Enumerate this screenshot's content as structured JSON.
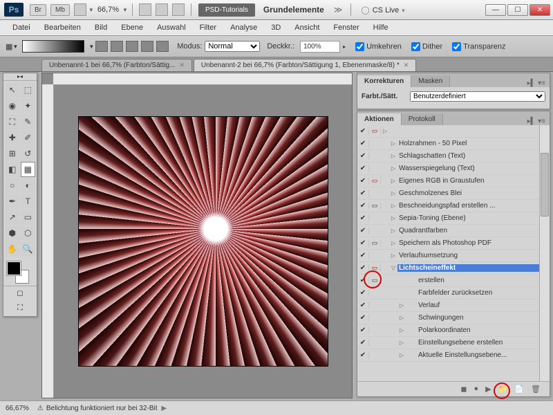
{
  "title": {
    "workspace": "PSD-Tutorials",
    "doc": "Grundelemente",
    "zoom": "66,7%",
    "cslive": "CS Live",
    "chips": [
      "Br",
      "Mb"
    ]
  },
  "menu": [
    "Datei",
    "Bearbeiten",
    "Bild",
    "Ebene",
    "Auswahl",
    "Filter",
    "Analyse",
    "3D",
    "Ansicht",
    "Fenster",
    "Hilfe"
  ],
  "opt": {
    "modus_lbl": "Modus:",
    "modus_val": "Normal",
    "deck_lbl": "Deckkr.:",
    "deck_val": "100%",
    "umk": "Umkehren",
    "dit": "Dither",
    "tra": "Transparenz"
  },
  "tabs": [
    {
      "label": "Unbenannt-1 bei 66,7% (Farbton/Sättig...",
      "active": false
    },
    {
      "label": "Unbenannt-2 bei 66,7% (Farbton/Sättigung 1, Ebenenmaske/8) *",
      "active": true
    }
  ],
  "corr": {
    "tabs": [
      "Korrekturen",
      "Masken"
    ],
    "field_lbl": "Farbt./Sätt.",
    "preset": "Benutzerdefiniert"
  },
  "act": {
    "tabs": [
      "Aktionen",
      "Protokoll"
    ],
    "items": [
      {
        "ck": "✔",
        "md": "▭",
        "mdred": true,
        "tg": "▷",
        "name": "",
        "ind": 0
      },
      {
        "ck": "✔",
        "md": "",
        "tg": "▷",
        "name": "Holzrahmen - 50 Pixel",
        "ind": 1
      },
      {
        "ck": "✔",
        "md": "",
        "tg": "▷",
        "name": "Schlagschatten (Text)",
        "ind": 1
      },
      {
        "ck": "✔",
        "md": "",
        "tg": "▷",
        "name": "Wasserspiegelung (Text)",
        "ind": 1
      },
      {
        "ck": "✔",
        "md": "▭",
        "mdred": true,
        "tg": "▷",
        "name": "Eigenes RGB in Graustufen",
        "ind": 1
      },
      {
        "ck": "✔",
        "md": "",
        "tg": "▷",
        "name": "Geschmolzenes Blei",
        "ind": 1
      },
      {
        "ck": "✔",
        "md": "▭",
        "tg": "▷",
        "name": "Beschneidungspfad erstellen ...",
        "ind": 1
      },
      {
        "ck": "✔",
        "md": "",
        "tg": "▷",
        "name": "Sepia-Toning (Ebene)",
        "ind": 1
      },
      {
        "ck": "✔",
        "md": "",
        "tg": "▷",
        "name": "Quadrantfarben",
        "ind": 1
      },
      {
        "ck": "✔",
        "md": "▭",
        "tg": "▷",
        "name": "Speichern als Photoshop PDF",
        "ind": 1
      },
      {
        "ck": "✔",
        "md": "",
        "tg": "▷",
        "name": "Verlaufsumsetzung",
        "ind": 1
      },
      {
        "ck": "✔",
        "md": "▭",
        "mdred": true,
        "tg": "▽",
        "name": "Lichtscheineffekt",
        "ind": 1,
        "sel": true
      },
      {
        "ck": "✔",
        "md": "▭",
        "tg": "",
        "name": "erstellen",
        "ind": 2
      },
      {
        "ck": "✔",
        "md": "",
        "tg": "",
        "name": "Farbfelder zurücksetzen",
        "ind": 2
      },
      {
        "ck": "✔",
        "md": "",
        "tg": "▷",
        "name": "Verlauf",
        "ind": 2
      },
      {
        "ck": "✔",
        "md": "",
        "tg": "▷",
        "name": "Schwingungen",
        "ind": 2
      },
      {
        "ck": "✔",
        "md": "",
        "tg": "▷",
        "name": "Polarkoordinaten",
        "ind": 2
      },
      {
        "ck": "✔",
        "md": "",
        "tg": "▷",
        "name": "Einstellungsebene erstellen",
        "ind": 2
      },
      {
        "ck": "✔",
        "md": "",
        "tg": "▷",
        "name": "Aktuelle Einstellungsebene...",
        "ind": 2
      }
    ]
  },
  "status": {
    "zoom": "66,67%",
    "msg": "Belichtung funktioniert nur bei 32-Bit"
  }
}
